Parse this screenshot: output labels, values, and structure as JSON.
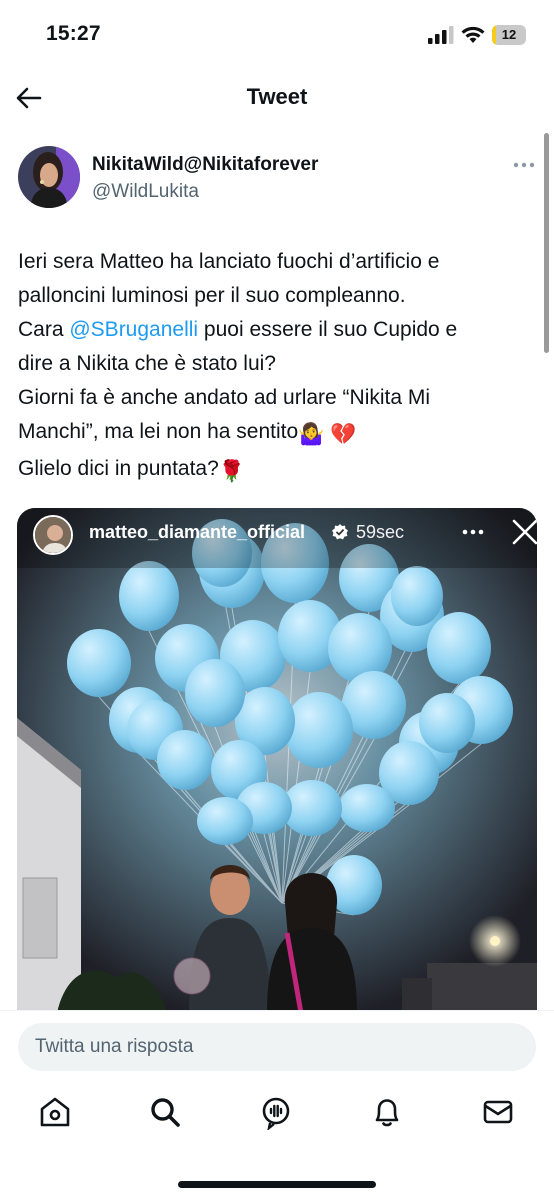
{
  "status_bar": {
    "time": "15:27",
    "battery_level": "12",
    "battery_fraction": 0.12,
    "signal_icon": "signal-bars-icon",
    "wifi_icon": "wifi-icon"
  },
  "header": {
    "title": "Tweet",
    "back_icon": "back-arrow-icon"
  },
  "tweet": {
    "author_name": "NikitaWild@Nikitaforever",
    "author_handle": "@WildLukita",
    "line1": "Ieri sera Matteo ha lanciato fuochi d’artificio e",
    "line2": "palloncini luminosi per il suo compleanno.",
    "line3_before": "Cara ",
    "line3_mention": "@SBruganelli",
    "line3_after": " puoi essere il suo Cupido e",
    "line4": "dire a Nikita che è stato lui?",
    "line5": "Giorni fa è anche andato ad urlare “Nikita Mi",
    "line6_text": "Manchi”, ma lei non ha sentito",
    "line6_emoji1": "🤷‍♀️",
    "line6_emoji2": "💔",
    "line7_text": "Glielo dici in puntata?",
    "line7_emoji": "🌹",
    "mention_color": "#1d9bf0"
  },
  "media": {
    "story_user": "matteo_diamante_official",
    "story_time": "59sec",
    "balloon_color": "#8fd3f2"
  },
  "reply": {
    "placeholder": "Twitta una risposta"
  },
  "tabs": [
    "home-icon",
    "search-icon",
    "spaces-icon",
    "notifications-bell-icon",
    "messages-envelope-icon"
  ]
}
